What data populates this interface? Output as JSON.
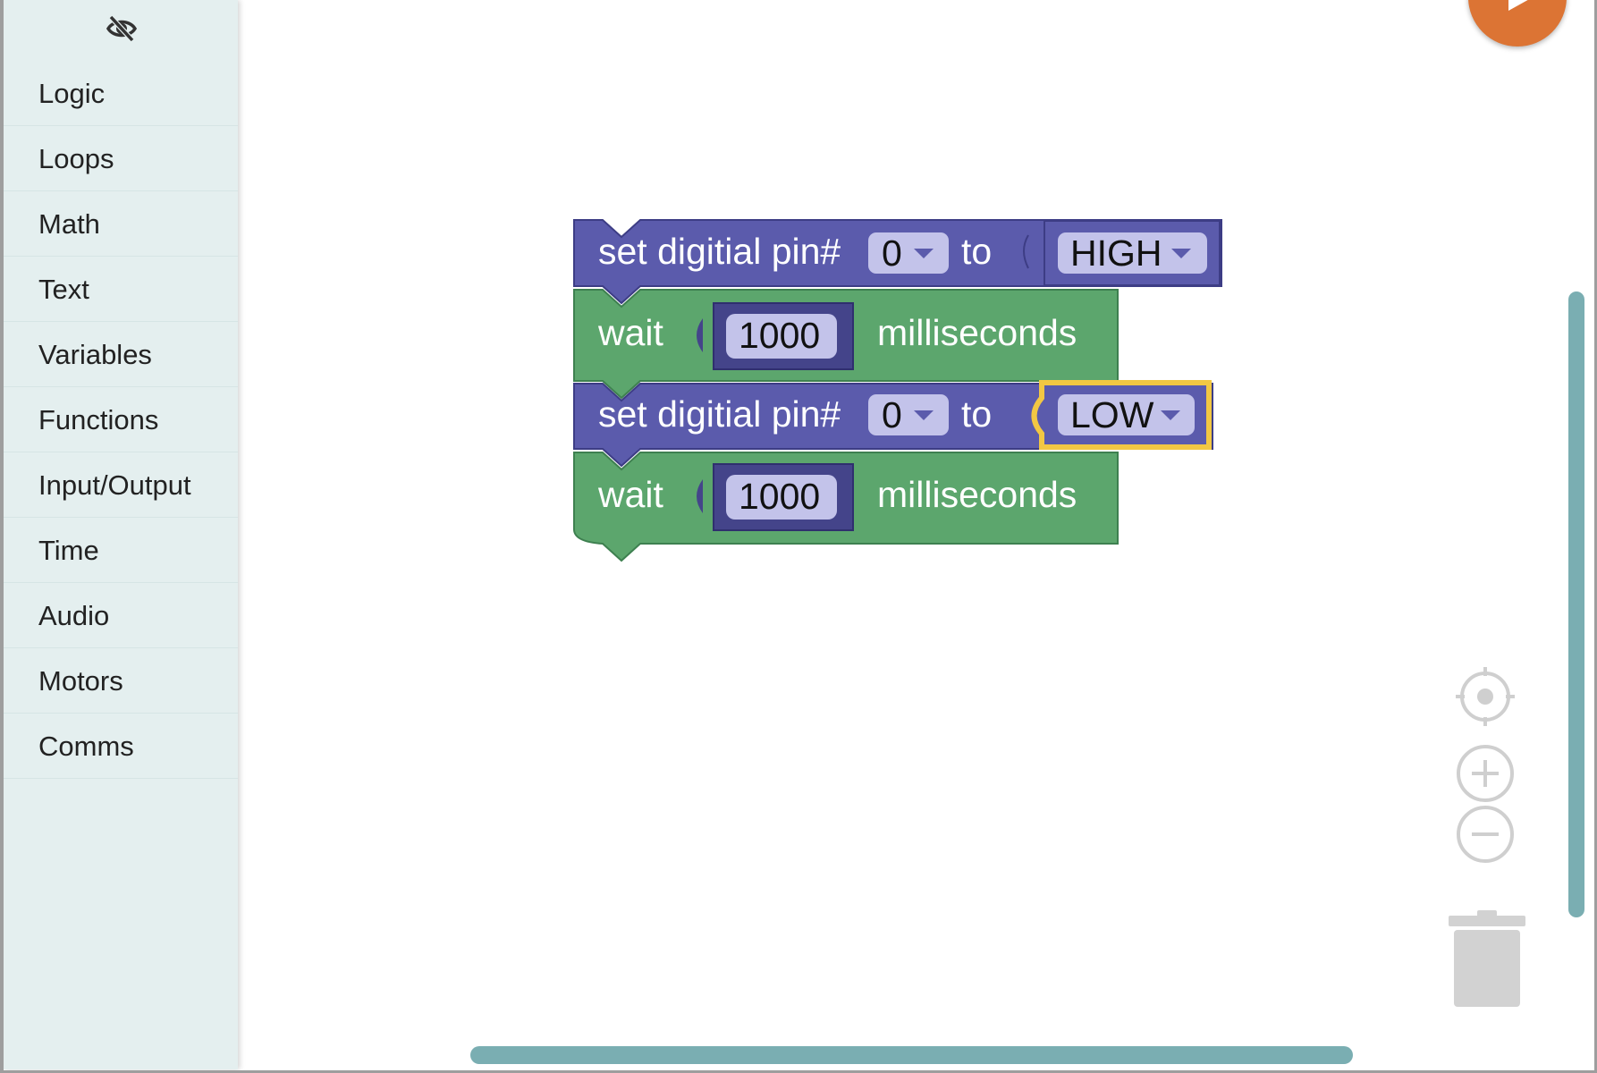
{
  "sidebar": {
    "hide_icon": "eye-slash-icon",
    "categories": [
      {
        "label": "Logic"
      },
      {
        "label": "Loops"
      },
      {
        "label": "Math"
      },
      {
        "label": "Text"
      },
      {
        "label": "Variables"
      },
      {
        "label": "Functions"
      },
      {
        "label": "Input/Output"
      },
      {
        "label": "Time"
      },
      {
        "label": "Audio"
      },
      {
        "label": "Motors"
      },
      {
        "label": "Comms"
      }
    ]
  },
  "blocks": [
    {
      "type": "set_digital_pin",
      "label": "set digitial pin#",
      "pin": "0",
      "to_label": "to",
      "value": "HIGH",
      "selected": false
    },
    {
      "type": "wait",
      "label": "wait",
      "amount": "1000",
      "unit": "milliseconds"
    },
    {
      "type": "set_digital_pin",
      "label": "set digitial pin#",
      "pin": "0",
      "to_label": "to",
      "value": "LOW",
      "selected": true
    },
    {
      "type": "wait",
      "label": "wait",
      "amount": "1000",
      "unit": "milliseconds"
    }
  ],
  "colors": {
    "sidebar_bg": "#e4efef",
    "pin_block": "#5b5bac",
    "pin_block_dark": "#44448a",
    "wait_block": "#5ca66d",
    "field_bg": "#c3c3ea",
    "highlight": "#f2c743",
    "run_button": "#dc7434",
    "scrollbar": "#7aaeb2"
  },
  "controls": {
    "run_icon": "play-icon",
    "recenter_icon": "crosshair-icon",
    "zoom_in_icon": "plus-circle-icon",
    "zoom_out_icon": "minus-circle-icon",
    "trash_icon": "trash-icon"
  }
}
